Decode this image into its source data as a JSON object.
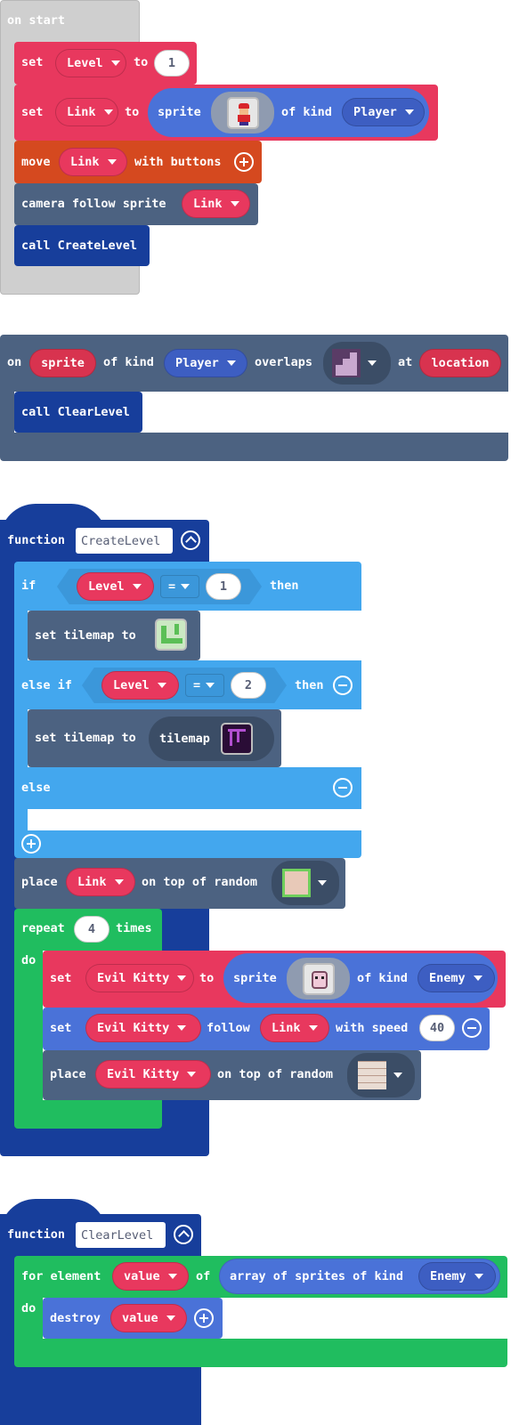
{
  "colors": {
    "event_gray": "#cfcfcf",
    "variables_red": "#e8385e",
    "sprites_blue": "#4a72d8",
    "controller_orange": "#d5491f",
    "scene_slate": "#4c6281",
    "functions_navy": "#173e9b",
    "logic_blue": "#43a7ee",
    "loops_green": "#20bd5f"
  },
  "on_start": {
    "hat_label": "on start",
    "set_level": {
      "set": "set",
      "variable": "Level",
      "to": "to",
      "value": "1"
    },
    "set_link": {
      "set": "set",
      "variable": "Link",
      "to": "to",
      "sprite": "sprite",
      "of_kind": "of kind",
      "kind": "Player",
      "image_icon": "mario-sprite-icon"
    },
    "move": {
      "move": "move",
      "variable": "Link",
      "with_buttons": "with buttons"
    },
    "camera": {
      "label": "camera follow sprite",
      "variable": "Link"
    },
    "call": {
      "label": "call CreateLevel"
    }
  },
  "overlap_event": {
    "on": "on",
    "sprite": "sprite",
    "of_kind": "of kind",
    "kind": "Player",
    "overlaps": "overlaps",
    "tile_icon": "stairs-tile-icon",
    "at": "at",
    "location": "location",
    "call": "call ClearLevel"
  },
  "create_level": {
    "function": "function",
    "name": "CreateLevel",
    "if": "if",
    "variable1": "Level",
    "eq1": "=",
    "val1": "1",
    "then": "then",
    "set_tilemap1": "set tilemap to",
    "tilemap1_icon": "green-tilemap-icon",
    "else_if": "else if",
    "variable2": "Level",
    "eq2": "=",
    "val2": "2",
    "then2": "then",
    "set_tilemap2": "set tilemap to",
    "tilemap_label": "tilemap",
    "tilemap2_icon": "purple-tilemap-icon",
    "else": "else",
    "place": "place",
    "place_var": "Link",
    "on_top": "on top of random",
    "place_tile_icon": "grass-tile-icon",
    "repeat": "repeat",
    "times_value": "4",
    "times": "times",
    "do": "do",
    "set_kitty": {
      "set": "set",
      "variable": "Evil Kitty",
      "to": "to",
      "sprite": "sprite",
      "of_kind": "of kind",
      "kind": "Enemy",
      "image_icon": "kitty-sprite-icon"
    },
    "follow": {
      "set": "set",
      "variable": "Evil Kitty",
      "follow": "follow",
      "target": "Link",
      "with_speed": "with speed",
      "speed": "40"
    },
    "place_kitty": {
      "place": "place",
      "variable": "Evil Kitty",
      "on_top": "on top of random",
      "tile_icon": "brick-tile-icon"
    }
  },
  "clear_level": {
    "function": "function",
    "name": "ClearLevel",
    "for_element": "for element",
    "variable": "value",
    "of": "of",
    "array_label": "array of sprites of kind",
    "kind": "Enemy",
    "do": "do",
    "destroy": "destroy",
    "destroy_var": "value"
  }
}
